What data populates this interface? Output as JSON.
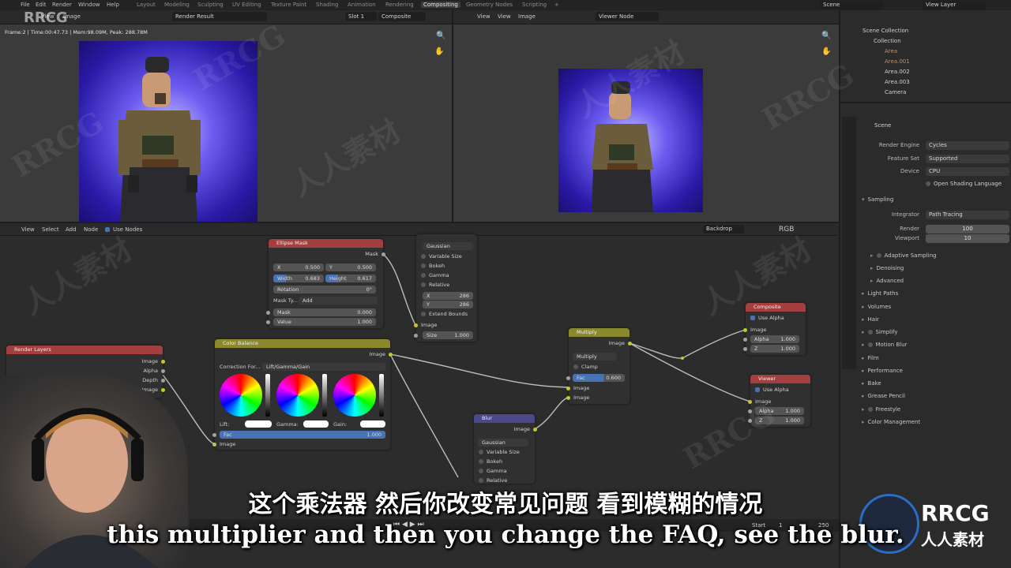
{
  "menu": [
    "File",
    "Edit",
    "Render",
    "Window",
    "Help"
  ],
  "workspaces": [
    "Layout",
    "Modeling",
    "Sculpting",
    "UV Editing",
    "Texture Paint",
    "Shading",
    "Animation",
    "Rendering",
    "Compositing",
    "Geometry Nodes",
    "Scripting"
  ],
  "active_workspace": "Compositing",
  "scene_name": "Scene",
  "view_layer": "View Layer",
  "left_editor": {
    "menus": [
      "View",
      "Image"
    ],
    "image_name": "Render Result",
    "slot": "Slot 1",
    "pass": "Composite",
    "stats": "Frame:2 | Time:00:47.73 | Mem:98.09M, Peak: 288.78M"
  },
  "right_editor": {
    "menus": [
      "View",
      "View",
      "Image"
    ],
    "image_name": "Viewer Node"
  },
  "outliner": {
    "title": "Scene Collection",
    "items": [
      "Collection",
      "Area",
      "Area.001",
      "Area.002",
      "Area.003",
      "Camera"
    ]
  },
  "properties": {
    "object": "Scene",
    "render_engine_label": "Render Engine",
    "render_engine": "Cycles",
    "feature_set_label": "Feature Set",
    "feature_set": "Supported",
    "device_label": "Device",
    "device": "CPU",
    "osl_label": "Open Shading Language",
    "sampling": "Sampling",
    "integrator_label": "Integrator",
    "integrator": "Path Tracing",
    "render_label": "Render",
    "render_samples": "100",
    "viewport_label": "Viewport",
    "viewport_samples": "10",
    "subsections": [
      "Adaptive Sampling",
      "Denoising",
      "Advanced"
    ],
    "sections": [
      "Light Paths",
      "Volumes",
      "Hair",
      "Simplify",
      "Motion Blur",
      "Film",
      "Performance",
      "Bake",
      "Grease Pencil",
      "Freestyle",
      "Color Management"
    ]
  },
  "node_header": {
    "menus": [
      "View",
      "Select",
      "Add",
      "Node"
    ],
    "use_nodes": "Use Nodes",
    "backdrop": "Backdrop",
    "channels": "RGB"
  },
  "nodes": {
    "ellipse": {
      "title": "Ellipse Mask",
      "out": "Mask",
      "x_label": "X",
      "x": "0.500",
      "y_label": "Y",
      "y": "0.500",
      "w_label": "Width",
      "w": "0.683",
      "h_label": "Height",
      "h": "0.617",
      "rot_label": "Rotation",
      "rot": "0°",
      "type_label": "Mask Ty...",
      "type": "Add",
      "mask_label": "Mask",
      "mask": "0.000",
      "value_label": "Value",
      "value": "1.000"
    },
    "blur_top": {
      "filter": "Gaussian",
      "opts": [
        "Variable Size",
        "Bokeh",
        "Gamma",
        "Relative"
      ],
      "x_label": "X",
      "x": "286",
      "y_label": "Y",
      "y": "286",
      "extend": "Extend Bounds",
      "in": "Image",
      "size_label": "Size",
      "size": "1.000"
    },
    "render_layers": {
      "title": "Render Layers",
      "outs": [
        "Image",
        "Alpha",
        "Depth",
        "Image"
      ]
    },
    "color_balance": {
      "title": "Color Balance",
      "out": "Image",
      "method_label": "Correction For...",
      "method": "Lift/Gamma/Gain",
      "lift": "Lift:",
      "gamma": "Gamma:",
      "gain": "Gain:",
      "fac_label": "Fac",
      "fac": "1.000",
      "in": "Image"
    },
    "multiply": {
      "title": "Multiply",
      "out": "Image",
      "op": "Multiply",
      "clamp": "Clamp",
      "fac_label": "Fac",
      "fac": "0.600",
      "in1": "Image",
      "in2": "Image"
    },
    "blur": {
      "title": "Blur",
      "out": "Image",
      "filter": "Gaussian",
      "opts": [
        "Variable Size",
        "Bokeh",
        "Gamma",
        "Relative"
      ]
    },
    "composite": {
      "title": "Composite",
      "use_alpha": "Use Alpha",
      "in": "Image",
      "alpha_label": "Alpha",
      "alpha": "1.000",
      "z_label": "Z",
      "z": "1.000"
    },
    "viewer": {
      "title": "Viewer",
      "use_alpha": "Use Alpha",
      "in": "Image",
      "alpha_label": "Alpha",
      "alpha": "1.000",
      "z_label": "Z",
      "z": "1.000"
    }
  },
  "timeline": {
    "start_label": "Start",
    "start": "1",
    "end": "250"
  },
  "subtitles": {
    "zh": "这个乘法器 然后你改变常见问题 看到模糊的情况",
    "en": "this multiplier and then you change the FAQ, see the blur."
  },
  "watermarks": {
    "brand": "RRCG",
    "cn": "人人素材"
  },
  "colors": {
    "accent": "#4772b3",
    "node_header_red": "#a33f3f",
    "node_header_yellow": "#8a8a2c",
    "node_header_blue": "#4a4a8a"
  }
}
